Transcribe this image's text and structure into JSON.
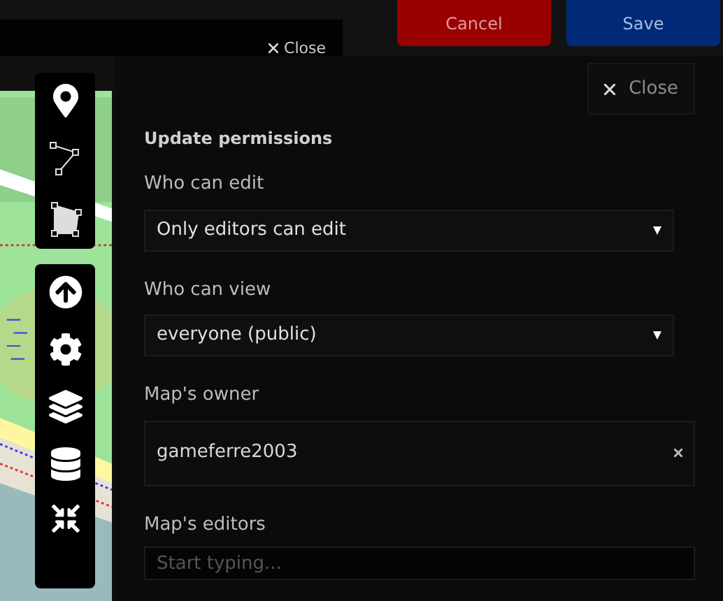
{
  "top_bar": {
    "close_label": "Close",
    "buttons": [
      {
        "label": "Cancel",
        "kind": "cancel"
      },
      {
        "label": "Save",
        "kind": "save"
      }
    ]
  },
  "map": {
    "kind": "picture"
  },
  "toolbar_groups": [
    [
      {
        "kind": "marker"
      },
      {
        "kind": "polyline"
      },
      {
        "kind": "polygon"
      }
    ],
    [
      {
        "kind": "upload"
      },
      {
        "kind": "settings"
      },
      {
        "kind": "layers"
      },
      {
        "kind": "data"
      },
      {
        "kind": "collapse"
      }
    ]
  ],
  "panel": {
    "close_label": "Close",
    "title": "Update permissions",
    "fields": [
      {
        "label": "Who can edit",
        "kind": "select",
        "value": "Only editors can edit"
      },
      {
        "label": "Who can view",
        "kind": "select",
        "value": "everyone (public)"
      },
      {
        "label": "Map's owner",
        "kind": "chip",
        "value": "gameferre2003"
      },
      {
        "label": "Map's editors",
        "kind": "input",
        "placeholder": "Start typing..."
      }
    ]
  }
}
